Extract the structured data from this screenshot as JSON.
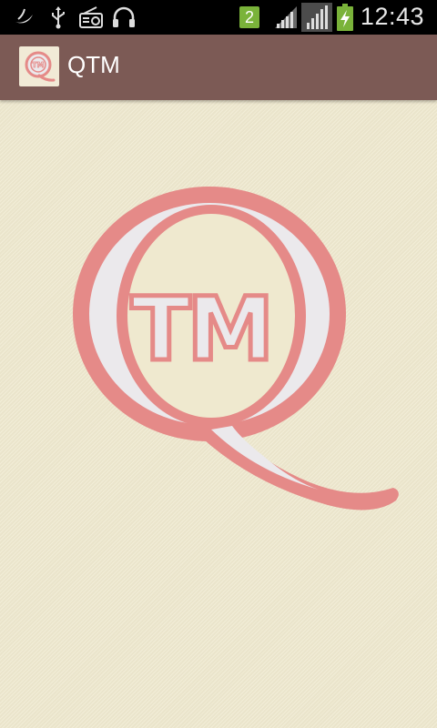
{
  "status_bar": {
    "icons": [
      "do-not-disturb-moon-icon",
      "usb-icon",
      "radio-icon",
      "headphones-icon",
      "sim-card-icon",
      "signal-icon",
      "signal-icon",
      "battery-charging-icon"
    ],
    "sim_number": "2",
    "time": "12:43"
  },
  "action_bar": {
    "title": "QTM",
    "icon": "qtm-app-icon",
    "color": "#7c5a55"
  },
  "logo": {
    "text": "TM",
    "icon": "qtm-logo",
    "primary_color": "#e58a88",
    "fill_color": "#ebe9ec"
  },
  "background_color": "#efe9cf"
}
